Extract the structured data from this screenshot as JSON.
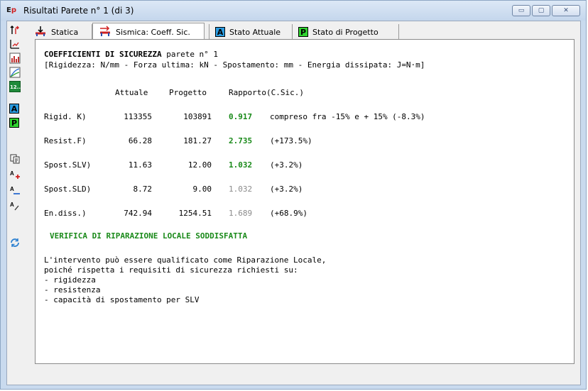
{
  "window": {
    "title": "Risultati Parete n° 1 (di 3)",
    "app_icon": "Ep",
    "buttons": {
      "minimize": "▭",
      "maximize": "▢",
      "close": "✕"
    }
  },
  "left_toolbar": {
    "items": [
      "wall-arrows-icon",
      "wall-axis-icon",
      "chart-icon",
      "curve-chart-icon",
      "number-12-icon",
      "A",
      "P",
      "copy-icon",
      "font-increase-icon",
      "font-decrease-icon",
      "font-italic-icon",
      "refresh-icon"
    ],
    "badge_A": "A",
    "badge_P": "P",
    "num12": "12.."
  },
  "tabs": [
    {
      "label": "Statica",
      "icon": "static-load-icon"
    },
    {
      "label": "Sismica: Coeff. Sic.",
      "icon": "seismic-load-icon",
      "active": true
    },
    {
      "label": "Stato Attuale",
      "badge": "A"
    },
    {
      "label": "Stato di Progetto",
      "badge": "P"
    }
  ],
  "content": {
    "heading": "COEFFICIENTI DI SICUREZZA",
    "heading_suffix": " parete n° 1",
    "units": "[Rigidezza: N/mm - Forza ultima: kN - Spostamento: mm - Energia dissipata: J=N·m]",
    "columns": {
      "attuale": "Attuale",
      "progetto": "Progetto",
      "rapporto": "Rapporto(C.Sic.)"
    },
    "rows": [
      {
        "label": "Rigid. K)",
        "attuale": "113355",
        "progetto": "103891",
        "ratio": "0.917",
        "ratio_color": "green",
        "note": "compreso fra -15% e + 15% (-8.3%)"
      },
      {
        "label": "Resist.F)",
        "attuale": "66.28",
        "progetto": "181.27",
        "ratio": "2.735",
        "ratio_color": "green",
        "note": "(+173.5%)"
      },
      {
        "label": "Spost.SLV)",
        "attuale": "11.63",
        "progetto": "12.00",
        "ratio": "1.032",
        "ratio_color": "green",
        "note": "(+3.2%)"
      },
      {
        "label": "Spost.SLD)",
        "attuale": "8.72",
        "progetto": "9.00",
        "ratio": "1.032",
        "ratio_color": "gray",
        "note": "(+3.2%)"
      },
      {
        "label": "En.diss.)",
        "attuale": "742.94",
        "progetto": "1254.51",
        "ratio": "1.689",
        "ratio_color": "gray",
        "note": "(+68.9%)"
      }
    ],
    "verdict": "VERIFICA DI RIPARAZIONE LOCALE SODDISFATTA",
    "paragraph": [
      "L'intervento può essere qualificato come Riparazione Locale,",
      "poiché rispetta i requisiti di sicurezza richiesti su:",
      "- rigidezza",
      "- resistenza",
      "- capacità di spostamento per SLV"
    ]
  },
  "colors": {
    "green": "#1a8a1a",
    "gray": "#8a8a8a",
    "badge_A": "#2a9be0",
    "badge_P": "#2fd32f"
  }
}
